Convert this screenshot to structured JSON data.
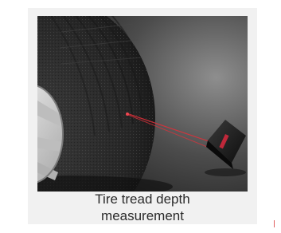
{
  "caption": {
    "line1": "Tire tread depth",
    "line2": "measurement"
  },
  "image": {
    "subject": "photo-tire-tread-laser-sensor",
    "colors": {
      "background_light": "#9a9a9a",
      "background_dark": "#1c1c1c",
      "tire": "#2a2a2a",
      "rim": "#d8d8d8",
      "laser": "#e0303a"
    }
  }
}
